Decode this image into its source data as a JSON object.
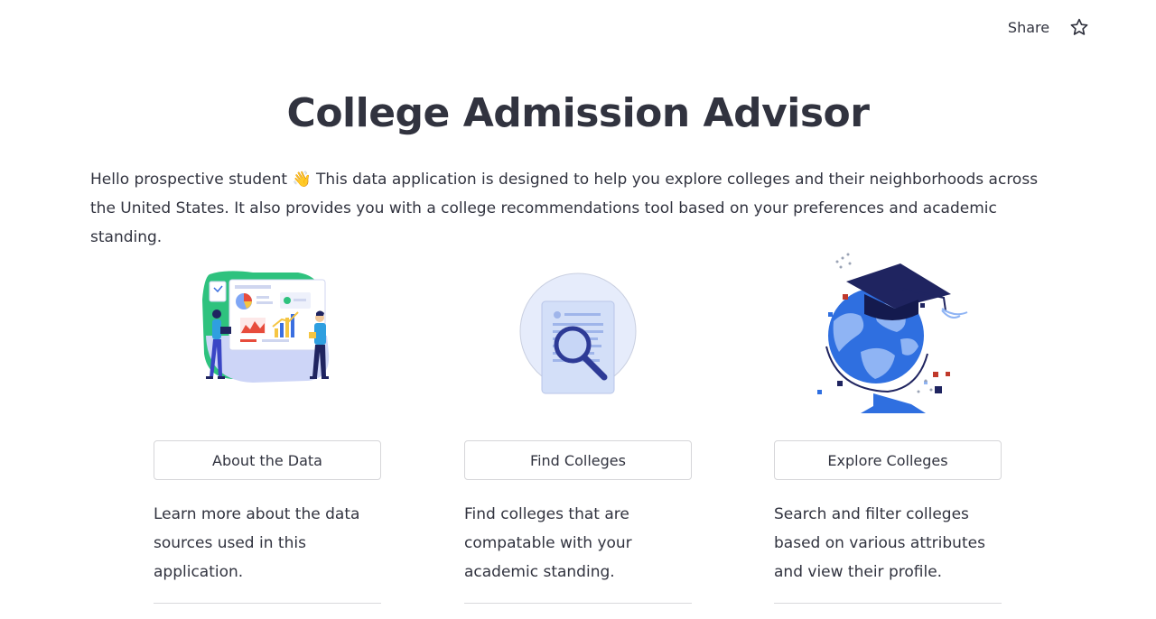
{
  "header": {
    "share_label": "Share",
    "star_icon": "star-icon"
  },
  "main": {
    "title": "College Admission Advisor",
    "intro_text": "Hello prospective student 👋 This data application is designed to help you explore colleges and their neighborhoods across the United States. It also provides you with a college recommendations tool based on your preferences and academic standing."
  },
  "cards": [
    {
      "illustration": "data-analytics-illustration",
      "button_label": "About the Data",
      "description": "Learn more about the data sources used in this application."
    },
    {
      "illustration": "document-search-illustration",
      "button_label": "Find Colleges",
      "description": "Find colleges that are compatable with your academic standing."
    },
    {
      "illustration": "graduation-globe-illustration",
      "button_label": "Explore Colleges",
      "description": "Search and filter colleges based on various attributes and view their profile."
    }
  ],
  "colors": {
    "text": "#31333f",
    "border": "#d6d6d9",
    "accent_blue": "#2f6fe0",
    "navy": "#1f2460",
    "green": "#2ec27e"
  }
}
